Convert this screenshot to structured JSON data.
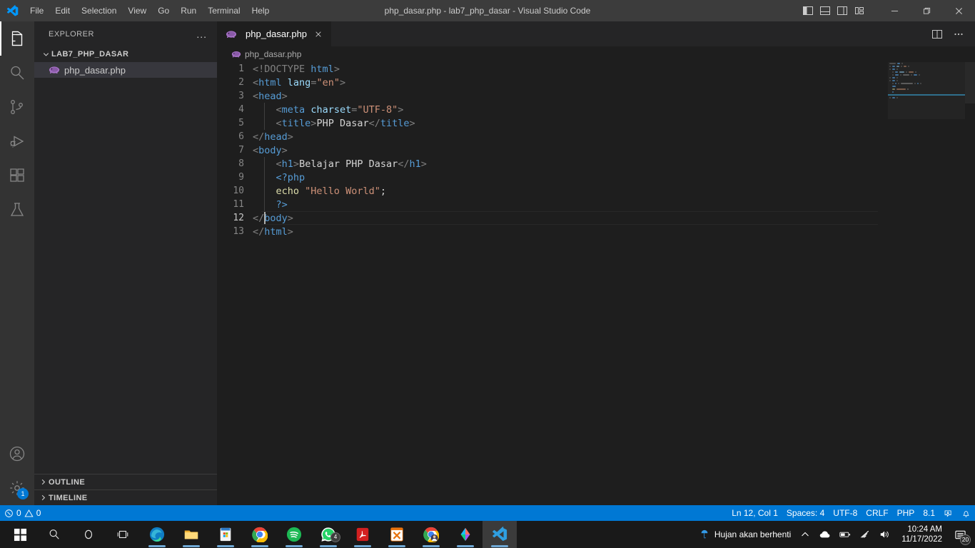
{
  "titlebar": {
    "logo_icon": "vscode-logo-icon",
    "menus": [
      "File",
      "Edit",
      "Selection",
      "View",
      "Go",
      "Run",
      "Terminal",
      "Help"
    ],
    "window_title": "php_dasar.php - lab7_php_dasar - Visual Studio Code",
    "layout_buttons": [
      {
        "name": "toggle-primary-sidebar",
        "icon": "panel-left-icon"
      },
      {
        "name": "toggle-panel",
        "icon": "panel-bottom-icon"
      },
      {
        "name": "toggle-secondary-sidebar",
        "icon": "panel-right-icon"
      },
      {
        "name": "customize-layout",
        "icon": "layout-grid-icon"
      }
    ],
    "window_controls": [
      {
        "name": "minimize",
        "icon": "minimize-icon"
      },
      {
        "name": "maximize",
        "icon": "maximize-icon"
      },
      {
        "name": "close",
        "icon": "close-icon"
      }
    ]
  },
  "activitybar": {
    "items": [
      {
        "name": "explorer",
        "icon": "files-icon",
        "active": true
      },
      {
        "name": "search",
        "icon": "search-icon",
        "active": false
      },
      {
        "name": "source-control",
        "icon": "source-control-icon",
        "active": false
      },
      {
        "name": "run-and-debug",
        "icon": "run-debug-icon",
        "active": false
      },
      {
        "name": "extensions",
        "icon": "extensions-icon",
        "active": false
      },
      {
        "name": "testing",
        "icon": "beaker-icon",
        "active": false
      }
    ],
    "bottom": [
      {
        "name": "accounts",
        "icon": "account-icon",
        "badge": ""
      },
      {
        "name": "manage-settings",
        "icon": "gear-icon",
        "badge": "1"
      }
    ]
  },
  "sidebar": {
    "title": "EXPLORER",
    "more_actions": "...",
    "folder": "LAB7_PHP_DASAR",
    "files": [
      {
        "name": "php_dasar.php",
        "icon": "php-file-icon",
        "selected": true
      }
    ],
    "collapsed_sections": [
      "OUTLINE",
      "TIMELINE"
    ]
  },
  "editor": {
    "tab": {
      "label": "php_dasar.php",
      "icon": "php-file-icon",
      "close_icon": "close-icon"
    },
    "actions": [
      {
        "name": "split-editor-right",
        "icon": "split-editor-icon"
      },
      {
        "name": "more-editor-actions",
        "icon": "ellipsis-icon"
      }
    ],
    "breadcrumb": "php_dasar.php",
    "language": "php",
    "current_line": 12,
    "lines": [
      {
        "n": 1,
        "indent": 0,
        "tokens": [
          {
            "t": "<!DOCTYPE",
            "c": "tk-br"
          },
          {
            "t": " ",
            "c": "tk-txt"
          },
          {
            "t": "html",
            "c": "tk-tag"
          },
          {
            "t": ">",
            "c": "tk-br"
          }
        ]
      },
      {
        "n": 2,
        "indent": 0,
        "tokens": [
          {
            "t": "<",
            "c": "tk-br"
          },
          {
            "t": "html",
            "c": "tk-tag"
          },
          {
            "t": " ",
            "c": "tk-txt"
          },
          {
            "t": "lang",
            "c": "tk-attr"
          },
          {
            "t": "=",
            "c": "tk-br"
          },
          {
            "t": "\"en\"",
            "c": "tk-str"
          },
          {
            "t": ">",
            "c": "tk-br"
          }
        ]
      },
      {
        "n": 3,
        "indent": 0,
        "tokens": [
          {
            "t": "<",
            "c": "tk-br"
          },
          {
            "t": "head",
            "c": "tk-tag"
          },
          {
            "t": ">",
            "c": "tk-br"
          }
        ]
      },
      {
        "n": 4,
        "indent": 1,
        "tokens": [
          {
            "t": "    ",
            "c": "tk-txt"
          },
          {
            "t": "<",
            "c": "tk-br"
          },
          {
            "t": "meta",
            "c": "tk-tag"
          },
          {
            "t": " ",
            "c": "tk-txt"
          },
          {
            "t": "charset",
            "c": "tk-attr"
          },
          {
            "t": "=",
            "c": "tk-br"
          },
          {
            "t": "\"UTF-8\"",
            "c": "tk-str"
          },
          {
            "t": ">",
            "c": "tk-br"
          }
        ]
      },
      {
        "n": 5,
        "indent": 1,
        "tokens": [
          {
            "t": "    ",
            "c": "tk-txt"
          },
          {
            "t": "<",
            "c": "tk-br"
          },
          {
            "t": "title",
            "c": "tk-tag"
          },
          {
            "t": ">",
            "c": "tk-br"
          },
          {
            "t": "PHP Dasar",
            "c": "tk-txt"
          },
          {
            "t": "</",
            "c": "tk-br"
          },
          {
            "t": "title",
            "c": "tk-tag"
          },
          {
            "t": ">",
            "c": "tk-br"
          }
        ]
      },
      {
        "n": 6,
        "indent": 0,
        "tokens": [
          {
            "t": "</",
            "c": "tk-br"
          },
          {
            "t": "head",
            "c": "tk-tag"
          },
          {
            "t": ">",
            "c": "tk-br"
          }
        ]
      },
      {
        "n": 7,
        "indent": 0,
        "tokens": [
          {
            "t": "<",
            "c": "tk-br"
          },
          {
            "t": "body",
            "c": "tk-tag"
          },
          {
            "t": ">",
            "c": "tk-br"
          }
        ]
      },
      {
        "n": 8,
        "indent": 1,
        "tokens": [
          {
            "t": "    ",
            "c": "tk-txt"
          },
          {
            "t": "<",
            "c": "tk-br"
          },
          {
            "t": "h1",
            "c": "tk-tag"
          },
          {
            "t": ">",
            "c": "tk-br"
          },
          {
            "t": "Belajar PHP Dasar",
            "c": "tk-txt"
          },
          {
            "t": "</",
            "c": "tk-br"
          },
          {
            "t": "h1",
            "c": "tk-tag"
          },
          {
            "t": ">",
            "c": "tk-br"
          }
        ]
      },
      {
        "n": 9,
        "indent": 1,
        "tokens": [
          {
            "t": "    ",
            "c": "tk-txt"
          },
          {
            "t": "<?php",
            "c": "tk-php"
          }
        ]
      },
      {
        "n": 10,
        "indent": 1,
        "tokens": [
          {
            "t": "    ",
            "c": "tk-txt"
          },
          {
            "t": "echo",
            "c": "tk-kw"
          },
          {
            "t": " ",
            "c": "tk-txt"
          },
          {
            "t": "\"Hello World\"",
            "c": "tk-str"
          },
          {
            "t": ";",
            "c": "tk-txt"
          }
        ]
      },
      {
        "n": 11,
        "indent": 1,
        "tokens": [
          {
            "t": "    ",
            "c": "tk-txt"
          },
          {
            "t": "?>",
            "c": "tk-php"
          }
        ]
      },
      {
        "n": 12,
        "indent": 0,
        "tokens": [
          {
            "t": "</",
            "c": "tk-br"
          },
          {
            "t": "body",
            "c": "tk-tag"
          },
          {
            "t": ">",
            "c": "tk-br"
          }
        ]
      },
      {
        "n": 13,
        "indent": 0,
        "tokens": [
          {
            "t": "</",
            "c": "tk-br"
          },
          {
            "t": "html",
            "c": "tk-tag"
          },
          {
            "t": ">",
            "c": "tk-br"
          }
        ]
      }
    ]
  },
  "statusbar": {
    "left": [
      {
        "name": "problems",
        "icon": "error-warning-icon",
        "label": "0  0",
        "errors": "0",
        "warnings": "0"
      }
    ],
    "right": [
      {
        "name": "editor-position",
        "label": "Ln 12, Col 1"
      },
      {
        "name": "editor-indentation",
        "label": "Spaces: 4"
      },
      {
        "name": "editor-encoding",
        "label": "UTF-8"
      },
      {
        "name": "editor-eol",
        "label": "CRLF"
      },
      {
        "name": "editor-language",
        "label": "PHP"
      },
      {
        "name": "php-version",
        "label": "8.1"
      },
      {
        "name": "feedback",
        "icon": "tweet-icon",
        "label": ""
      },
      {
        "name": "notifications",
        "icon": "bell-icon",
        "label": ""
      }
    ]
  },
  "taskbar": {
    "apps": [
      {
        "name": "start-button",
        "icon": "windows-logo-icon"
      },
      {
        "name": "search-button",
        "icon": "search-icon"
      },
      {
        "name": "cortana-button",
        "icon": "cortana-icon"
      },
      {
        "name": "task-view-button",
        "icon": "task-view-icon"
      },
      {
        "name": "microsoft-edge",
        "icon": "edge-icon"
      },
      {
        "name": "file-explorer",
        "icon": "folder-icon"
      },
      {
        "name": "microsoft-store",
        "icon": "store-icon"
      },
      {
        "name": "google-chrome",
        "icon": "chrome-icon"
      },
      {
        "name": "spotify",
        "icon": "spotify-icon"
      },
      {
        "name": "whatsapp",
        "icon": "whatsapp-icon",
        "badge": "4"
      },
      {
        "name": "adobe-acrobat",
        "icon": "acrobat-icon"
      },
      {
        "name": "xampp",
        "icon": "xampp-icon"
      },
      {
        "name": "chrome-profile",
        "icon": "chrome-profile-icon"
      },
      {
        "name": "figma",
        "icon": "figma-icon"
      },
      {
        "name": "visual-studio-code",
        "icon": "vscode-icon",
        "active": true
      }
    ],
    "tray": {
      "weather_icon": "umbrella-icon",
      "weather_text": "Hujan akan berhenti",
      "chevron_icon": "chevron-up-icon",
      "onedrive_icon": "cloud-icon",
      "battery_icon": "battery-icon",
      "network_icon": "wifi-icon",
      "volume_icon": "volume-icon",
      "time": "10:24 AM",
      "date": "11/17/2022",
      "notification_icon": "notification-icon",
      "notification_count": "20"
    }
  }
}
